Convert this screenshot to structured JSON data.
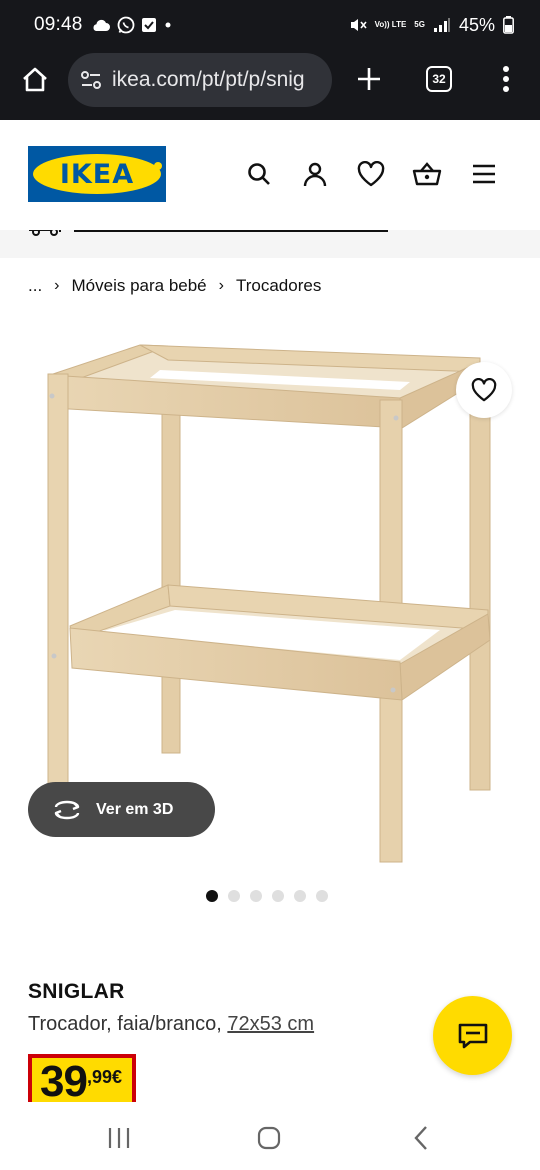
{
  "status_bar": {
    "time": "09:48",
    "left_icons": [
      "cloud-icon",
      "whatsapp-icon",
      "check-box-icon",
      "dot-icon"
    ],
    "volte_label": "Vo)) LTE",
    "network_label": "5G",
    "battery": "45%"
  },
  "browser": {
    "url": "ikea.com/pt/pt/p/snig",
    "tab_count": "32"
  },
  "header": {
    "logo_text": "IKEA",
    "icons": [
      "search-icon",
      "account-icon",
      "heart-icon",
      "basket-icon",
      "hamburger-menu-icon"
    ]
  },
  "breadcrumb": {
    "ellipsis": "...",
    "items": [
      "Móveis para bebé",
      "Trocadores"
    ],
    "separator": "›"
  },
  "gallery": {
    "view3d_label": "Ver em 3D",
    "dot_count": 6,
    "active_dot": 0
  },
  "product": {
    "name": "SNIGLAR",
    "description_prefix": "Trocador, faia/branco, ",
    "dimensions": "72x53 cm",
    "price_integer": "39",
    "price_decimal": ",99€"
  },
  "colors": {
    "ikea_blue": "#0058a3",
    "ikea_yellow": "#ffdb00",
    "price_red": "#cc0008",
    "browser_dark": "#16171b"
  }
}
